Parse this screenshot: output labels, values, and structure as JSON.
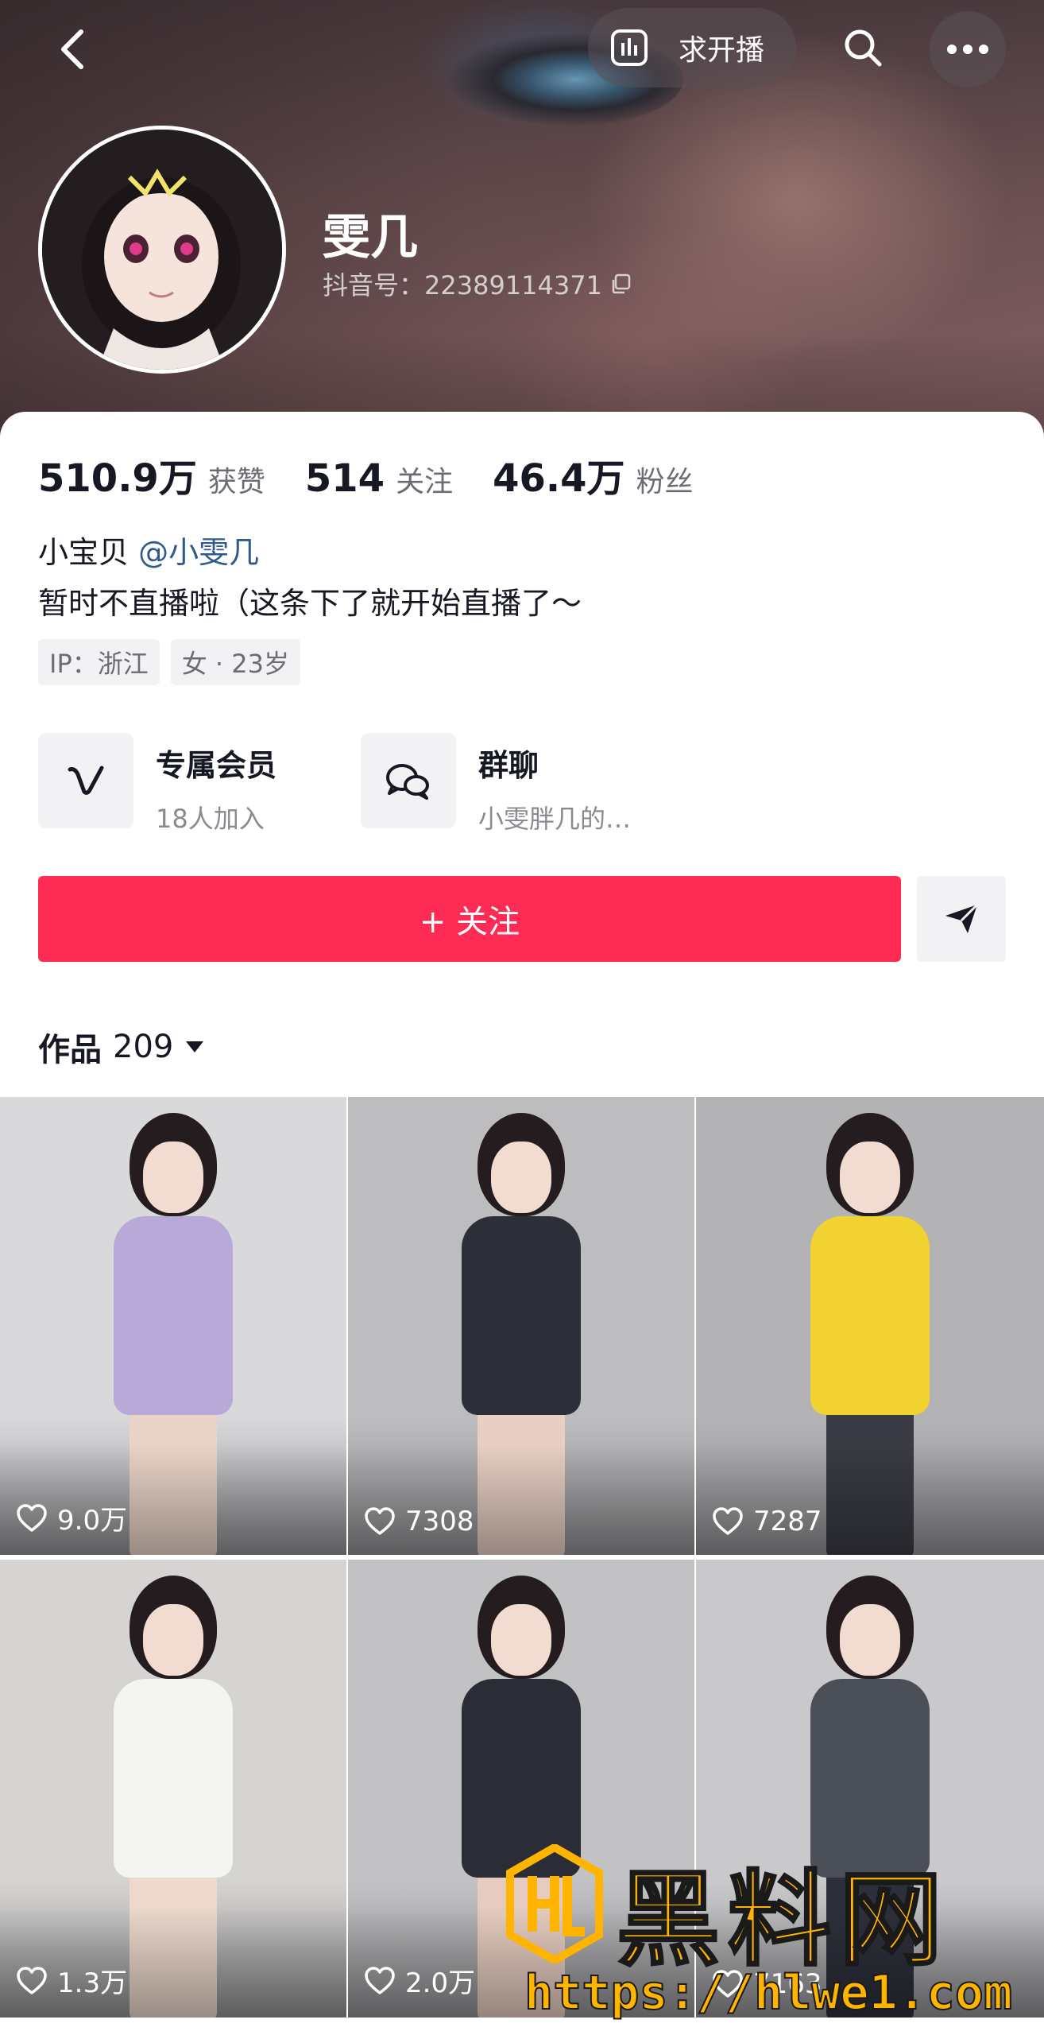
{
  "header": {
    "live_request_label": "求开播"
  },
  "profile": {
    "nickname": "雯几",
    "douyin_id": "抖音号：22389114371"
  },
  "stats": [
    {
      "value": "510.9万",
      "label": "获赞"
    },
    {
      "value": "514",
      "label": "关注"
    },
    {
      "value": "46.4万",
      "label": "粉丝"
    }
  ],
  "bio": {
    "line1_prefix": "小宝贝 ",
    "mention": "@小雯几",
    "line2": "暂时不直播啦（这条下了就开始直播了～"
  },
  "tags": [
    "IP：浙江",
    "女 · 23岁"
  ],
  "features": {
    "membership": {
      "title": "专属会员",
      "subtitle": "18人加入"
    },
    "group_chat": {
      "title": "群聊",
      "subtitle": "小雯胖几的…"
    }
  },
  "actions": {
    "follow_label": "+ 关注"
  },
  "works": {
    "label": "作品",
    "count": "209"
  },
  "videos": [
    {
      "likes": "9.0万",
      "outfit": "#b8a9d9",
      "legs": "#ead4c8",
      "bg": "#d9d9dc"
    },
    {
      "likes": "7308",
      "outfit": "#2c2f38",
      "legs": "#e8cfc4",
      "bg": "#bdbdbf"
    },
    {
      "likes": "7287",
      "outfit": "#f2d230",
      "legs": "#3a3a44",
      "bg": "#b3b3b6"
    },
    {
      "likes": "1.3万",
      "outfit": "#f4f4f2",
      "legs": "#ecd8cc",
      "bg": "#d6d4d2"
    },
    {
      "likes": "2.0万",
      "outfit": "#2a2d36",
      "legs": "#e6ccc0",
      "bg": "#c2c2c4"
    },
    {
      "likes": "7163",
      "outfit": "#4a4f58",
      "legs": "#2d2f3a",
      "bg": "#c9c9cb"
    }
  ],
  "watermark": {
    "title": "黑料网",
    "url": "https://hlwe1.com"
  },
  "colors": {
    "accent": "#fe2c55",
    "mention": "#2f5a8c",
    "watermark": "#ffb400"
  }
}
